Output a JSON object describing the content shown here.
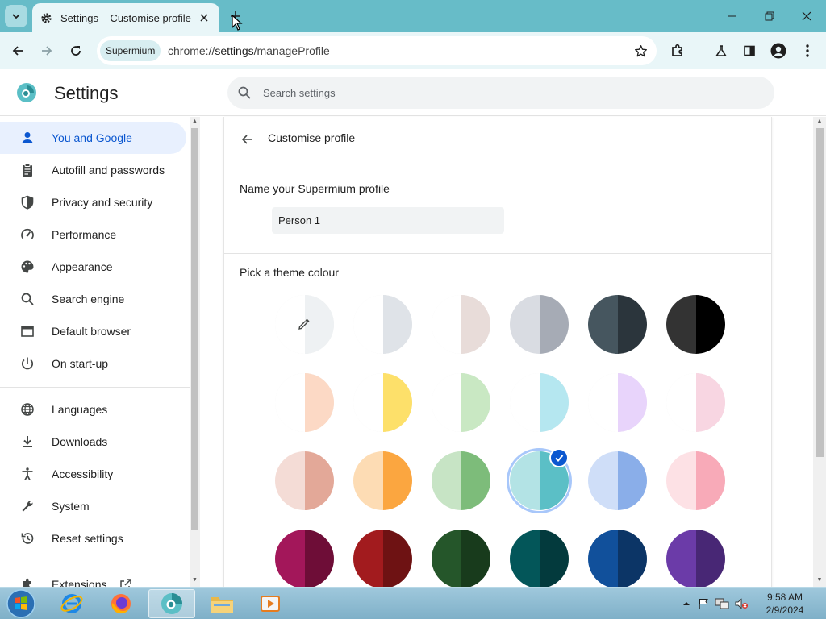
{
  "browser": {
    "tab_title": "Settings – Customise profile",
    "chip_label": "Supermium",
    "url_scheme": "chrome://",
    "url_host": "settings",
    "url_path": "/manageProfile"
  },
  "settings": {
    "title": "Settings",
    "search_placeholder": "Search settings"
  },
  "sidebar": {
    "items": [
      {
        "label": "You and Google",
        "icon": "person-icon"
      },
      {
        "label": "Autofill and passwords",
        "icon": "clipboard-icon"
      },
      {
        "label": "Privacy and security",
        "icon": "shield-icon"
      },
      {
        "label": "Performance",
        "icon": "gauge-icon"
      },
      {
        "label": "Appearance",
        "icon": "palette-icon"
      },
      {
        "label": "Search engine",
        "icon": "search-icon"
      },
      {
        "label": "Default browser",
        "icon": "browser-icon"
      },
      {
        "label": "On start-up",
        "icon": "power-icon"
      },
      {
        "label": "Languages",
        "icon": "globe-icon"
      },
      {
        "label": "Downloads",
        "icon": "download-icon"
      },
      {
        "label": "Accessibility",
        "icon": "accessibility-icon"
      },
      {
        "label": "System",
        "icon": "wrench-icon"
      },
      {
        "label": "Reset settings",
        "icon": "reset-icon"
      },
      {
        "label": "Extensions",
        "icon": "puzzle-icon"
      }
    ]
  },
  "profile": {
    "page_title": "Customise profile",
    "name_label": "Name your Supermium profile",
    "name_value": "Person 1",
    "theme_label": "Pick a theme colour",
    "selected_index": 15,
    "swatches": [
      {
        "l": "#ffffff",
        "r": "#eef1f3"
      },
      {
        "l": "#ffffff",
        "r": "#dfe3e8"
      },
      {
        "l": "#ffffff",
        "r": "#e8dcd9"
      },
      {
        "l": "#d9dce2",
        "r": "#a6abb5"
      },
      {
        "l": "#46565f",
        "r": "#2b353c"
      },
      {
        "l": "#333333",
        "r": "#000000"
      },
      {
        "l": "#ffffff",
        "r": "#fcd9c5"
      },
      {
        "l": "#ffffff",
        "r": "#fde06a"
      },
      {
        "l": "#ffffff",
        "r": "#c9e8c3"
      },
      {
        "l": "#ffffff",
        "r": "#b5e7f0"
      },
      {
        "l": "#ffffff",
        "r": "#e8d4fb"
      },
      {
        "l": "#ffffff",
        "r": "#f8d6e2"
      },
      {
        "l": "#f4dcd6",
        "r": "#e3a898"
      },
      {
        "l": "#fddcb4",
        "r": "#fba640"
      },
      {
        "l": "#c7e4c5",
        "r": "#7dbc7a"
      },
      {
        "l": "#b3e3e5",
        "r": "#5bbfc6"
      },
      {
        "l": "#cfdef8",
        "r": "#8aaee9"
      },
      {
        "l": "#fde1e5",
        "r": "#f8aab8"
      },
      {
        "l": "#a3175a",
        "r": "#6e0d37"
      },
      {
        "l": "#a21b1e",
        "r": "#6e1213"
      },
      {
        "l": "#25562a",
        "r": "#183b1c"
      },
      {
        "l": "#035659",
        "r": "#033a3d"
      },
      {
        "l": "#11509b",
        "r": "#0c3566"
      },
      {
        "l": "#6b3ba8",
        "r": "#482775"
      }
    ]
  },
  "taskbar": {
    "time": "9:58 AM",
    "date": "2/9/2024"
  },
  "colors": {
    "titlebar": "#67bcc8",
    "toolbar": "#e9f6f8",
    "accent": "#0b57d0",
    "active_nav_bg": "#e8f0fe"
  }
}
